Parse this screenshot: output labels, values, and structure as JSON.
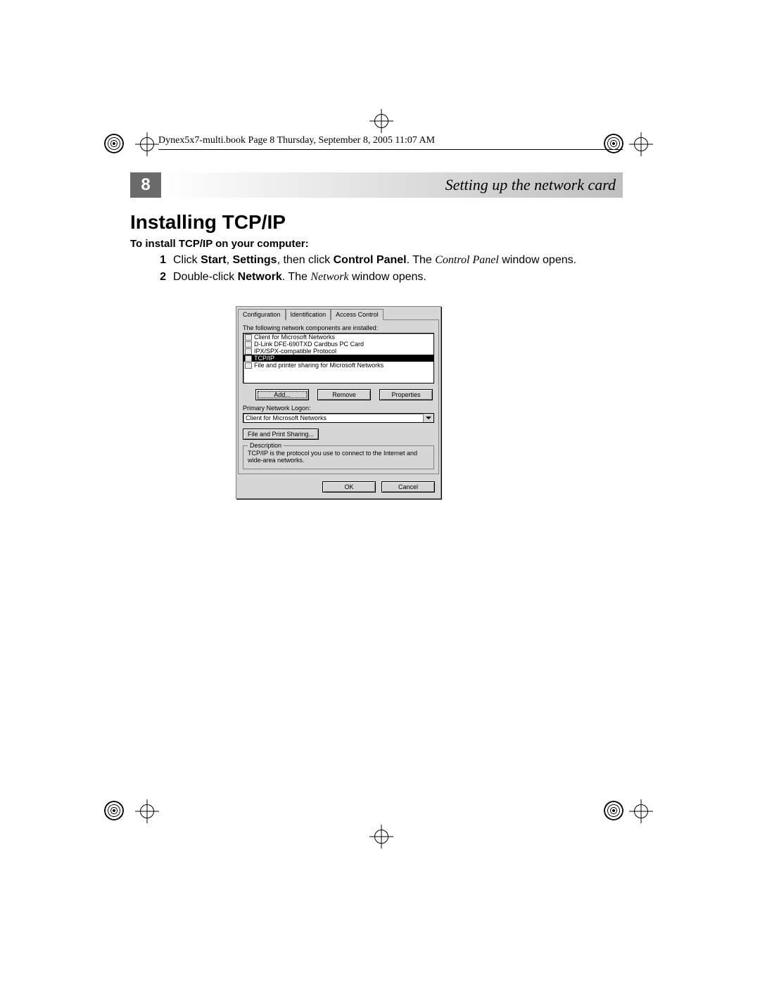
{
  "header": {
    "text": "Dynex5x7-multi.book  Page 8  Thursday, September 8, 2005  11:07 AM"
  },
  "banner": {
    "page_number": "8",
    "section_title": "Setting up the network card"
  },
  "heading": "Installing TCP/IP",
  "subheading": "To install TCP/IP on your computer:",
  "steps": [
    {
      "n": "1",
      "pre": "Click ",
      "b1": "Start",
      "mid1": ", ",
      "b2": "Settings",
      "mid2": ", then click ",
      "b3": "Control Panel",
      "mid3": ". The ",
      "i1": "Control Panel",
      "post": " window opens."
    },
    {
      "n": "2",
      "pre": "Double-click ",
      "b1": "Network",
      "mid1": ". The ",
      "i1": "Network",
      "post": " window opens."
    }
  ],
  "dialog": {
    "tabs": [
      "Configuration",
      "Identification",
      "Access Control"
    ],
    "list_label": "The following network components are installed:",
    "components": [
      "Client for Microsoft Networks",
      "D-Link DFE-690TXD Cardbus PC Card",
      "IPX/SPX-compatible Protocol",
      "TCP/IP",
      "File and printer sharing for Microsoft Networks"
    ],
    "selected_index": 3,
    "buttons": {
      "add": "Add...",
      "remove": "Remove",
      "properties": "Properties"
    },
    "primary_label": "Primary Network Logon:",
    "primary_value": "Client for Microsoft Networks",
    "fps_button": "File and Print Sharing...",
    "desc_legend": "Description",
    "desc_text": "TCP/IP is the protocol you use to connect to the Internet and wide-area networks.",
    "ok": "OK",
    "cancel": "Cancel"
  }
}
